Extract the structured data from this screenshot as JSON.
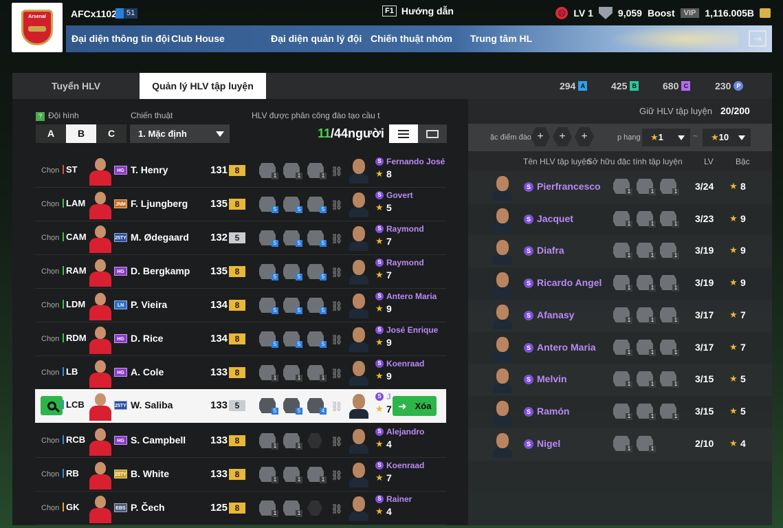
{
  "header": {
    "club_crest_text": "Arsenal",
    "team_name": "AFCx1102",
    "team_level": "51",
    "guide_key": "F1",
    "guide_label": "Hướng dẫn",
    "level": "LV 1",
    "trophies": "9,059",
    "boost_label": "Boost",
    "vip_label": "VIP",
    "coins": "1,116.005B"
  },
  "nav": [
    "Đại diện thông tin đội",
    "Club House",
    "Đại diện quản lý đội",
    "Chiến thuật nhóm",
    "Trung tâm HL"
  ],
  "tabs": [
    "Tuyển HLV",
    "Quản lý HLV tập luyện"
  ],
  "currencies": [
    {
      "value": "294",
      "tag": "A",
      "color": "#2fa0e8"
    },
    {
      "value": "425",
      "tag": "B",
      "color": "#2fc59a"
    },
    {
      "value": "680",
      "tag": "C",
      "color": "#b46cf0"
    },
    {
      "value": "230",
      "tag": "P",
      "color": "#6b86e0"
    }
  ],
  "left": {
    "formation_label": "Đội hình",
    "formation_buttons": [
      "A",
      "B",
      "C"
    ],
    "tactic_label": "Chiến thuật",
    "tactic_value": "1. Mặc định",
    "assigned_label": "HLV được phân công đào tạo cầu t",
    "assigned_current": "11",
    "assigned_total": "/44người",
    "choose_label": "Chọn",
    "delete_label": "Xóa"
  },
  "players": [
    {
      "pos": "ST",
      "pos_color": "#e84a4a",
      "season": "HG",
      "season_color": "#8a3cc8",
      "name": "T. Henry",
      "ovr": "131",
      "grade": "8",
      "skills": [
        "1",
        "1",
        "1"
      ],
      "coach": "Fernando José",
      "coach_level": "8"
    },
    {
      "pos": "LAM",
      "pos_color": "#43c24a",
      "season": "JNM",
      "season_color": "#c86a1e",
      "name": "F. Ljungberg",
      "ovr": "135",
      "grade": "8",
      "skills": [
        "5",
        "5",
        "5"
      ],
      "coach": "Govert",
      "coach_level": "5"
    },
    {
      "pos": "CAM",
      "pos_color": "#43c24a",
      "season": "25TY",
      "season_color": "#2b4fa0",
      "name": "M. Ødegaard",
      "ovr": "132",
      "grade": "5",
      "skills": [
        "5",
        "5",
        "5"
      ],
      "coach": "Raymond",
      "coach_level": "7"
    },
    {
      "pos": "RAM",
      "pos_color": "#43c24a",
      "season": "HG",
      "season_color": "#8a3cc8",
      "name": "D. Bergkamp",
      "ovr": "135",
      "grade": "8",
      "skills": [
        "5",
        "5",
        "5"
      ],
      "coach": "Raymond",
      "coach_level": "7"
    },
    {
      "pos": "LDM",
      "pos_color": "#43c24a",
      "season": "LN",
      "season_color": "#2b6fc8",
      "name": "P. Vieira",
      "ovr": "134",
      "grade": "8",
      "skills": [
        "5",
        "5",
        "5"
      ],
      "coach": "Antero Maria",
      "coach_level": "9"
    },
    {
      "pos": "RDM",
      "pos_color": "#43c24a",
      "season": "HG",
      "season_color": "#8a3cc8",
      "name": "D. Rice",
      "ovr": "134",
      "grade": "8",
      "skills": [
        "5",
        "5",
        "5"
      ],
      "coach": "José Enrique",
      "coach_level": "9"
    },
    {
      "pos": "LB",
      "pos_color": "#3a8ae8",
      "season": "HG",
      "season_color": "#8a3cc8",
      "name": "A. Cole",
      "ovr": "133",
      "grade": "8",
      "skills": [
        "1",
        "1",
        "1"
      ],
      "coach": "Koenraad",
      "coach_level": "9"
    },
    {
      "pos": "LCB",
      "pos_color": "#3a8ae8",
      "season": "25TY",
      "season_color": "#2b4fa0",
      "name": "W. Saliba",
      "ovr": "133",
      "grade": "5",
      "skills": [
        "5",
        "5",
        "4"
      ],
      "coach": "J",
      "coach_level": "7"
    },
    {
      "pos": "RCB",
      "pos_color": "#3a8ae8",
      "season": "HG",
      "season_color": "#8a3cc8",
      "name": "S. Campbell",
      "ovr": "133",
      "grade": "8",
      "skills": [
        "1",
        "1",
        ""
      ],
      "coach": "Alejandro",
      "coach_level": "4"
    },
    {
      "pos": "RB",
      "pos_color": "#3a8ae8",
      "season": "25TY",
      "season_color": "#c8a21e",
      "name": "B. White",
      "ovr": "133",
      "grade": "8",
      "skills": [
        "1",
        "1",
        "1"
      ],
      "coach": "Koenraad",
      "coach_level": "7"
    },
    {
      "pos": "GK",
      "pos_color": "#e8a43a",
      "season": "EBS",
      "season_color": "#4a5a78",
      "name": "P. Čech",
      "ovr": "125",
      "grade": "8",
      "skills": [
        "1",
        "1",
        ""
      ],
      "coach": "Rainer",
      "coach_level": "4"
    }
  ],
  "right": {
    "hold_label": "Giữ HLV tập luyện",
    "hold_value": "20/200",
    "trait_filter_label": "ặc điểm đào",
    "rank_label": "p hạng",
    "rank_from": "1",
    "rank_to": "10",
    "range_sep": "~",
    "columns": [
      "Tên HLV tập luyện",
      "Sở hữu đặc tính tập luyện",
      "LV",
      "Bậc"
    ]
  },
  "coaches": [
    {
      "name": "Pierfrancesco",
      "skills": 3,
      "lv": "3/24",
      "grade": "8"
    },
    {
      "name": "Jacquet",
      "skills": 3,
      "lv": "3/23",
      "grade": "9"
    },
    {
      "name": "Diafra",
      "skills": 3,
      "lv": "3/19",
      "grade": "9"
    },
    {
      "name": "Ricardo Angel",
      "skills": 3,
      "lv": "3/19",
      "grade": "9"
    },
    {
      "name": "Afanasy",
      "skills": 3,
      "lv": "3/17",
      "grade": "7"
    },
    {
      "name": "Antero Maria",
      "skills": 3,
      "lv": "3/17",
      "grade": "7"
    },
    {
      "name": "Melvin",
      "skills": 3,
      "lv": "3/15",
      "grade": "5"
    },
    {
      "name": "Ramón",
      "skills": 3,
      "lv": "3/15",
      "grade": "5"
    },
    {
      "name": "Nigel",
      "skills": 2,
      "lv": "2/10",
      "grade": "4"
    }
  ]
}
